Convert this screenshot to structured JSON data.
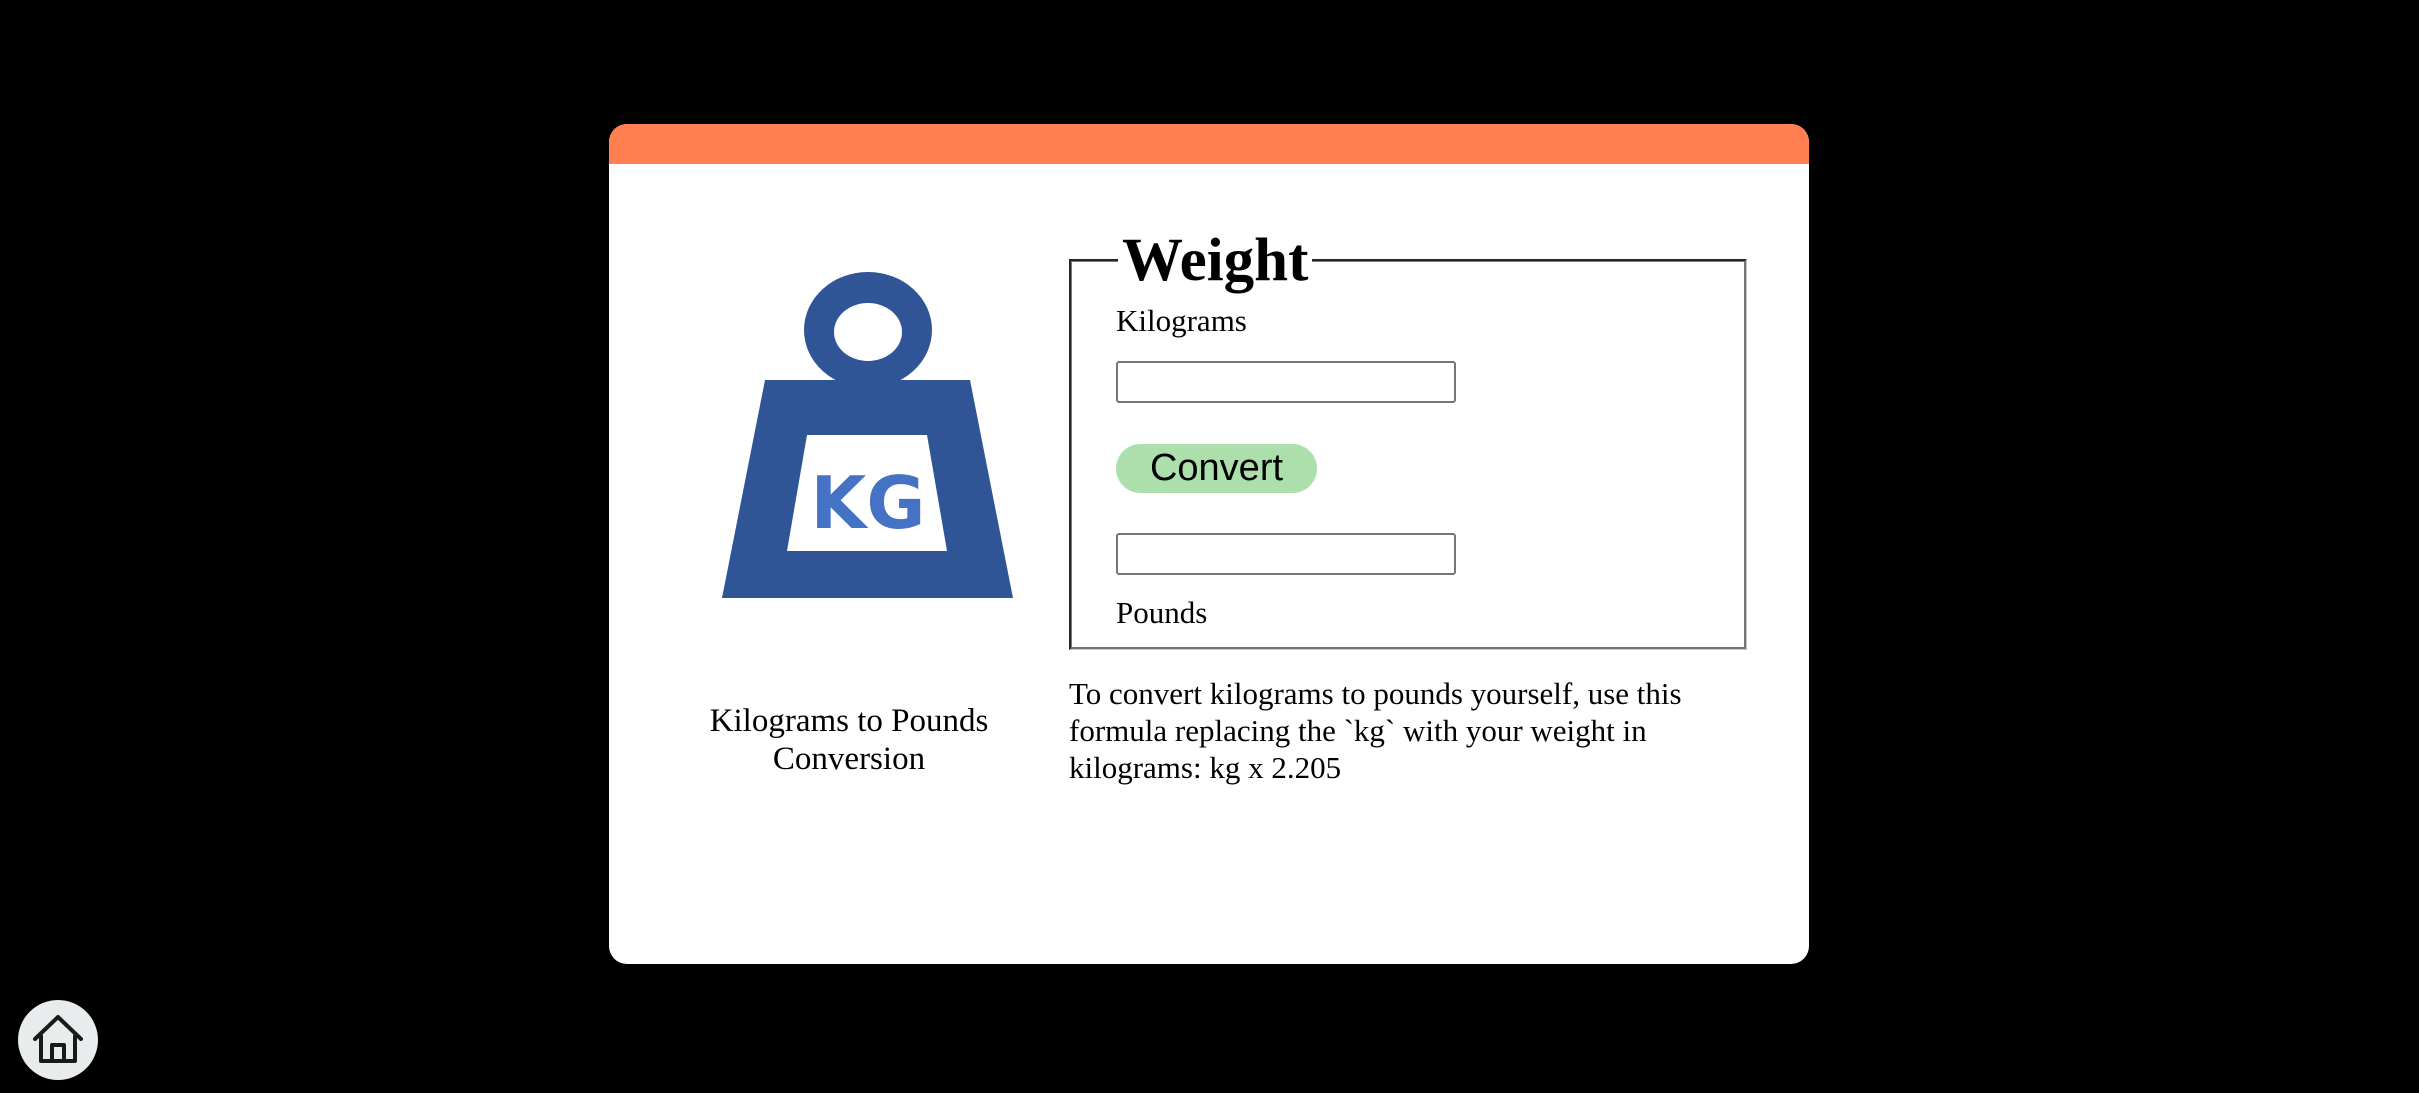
{
  "card": {
    "header_color": "#ff7f50",
    "logo": {
      "icon": "kg-weight-icon",
      "text": "KG",
      "color": "#2f5597"
    },
    "caption": "Kilograms to Pounds Conversion"
  },
  "converter": {
    "legend": "Weight",
    "kilograms_label": "Kilograms",
    "kilograms_value": "",
    "convert_label": "Convert",
    "convert_color": "#addfad",
    "pounds_value": "",
    "pounds_label": "Pounds"
  },
  "formula_text": "To convert kilograms to pounds yourself, use this formula replacing the `kg` with your weight in kilograms: kg x 2.205",
  "home": {
    "icon": "home-icon"
  }
}
